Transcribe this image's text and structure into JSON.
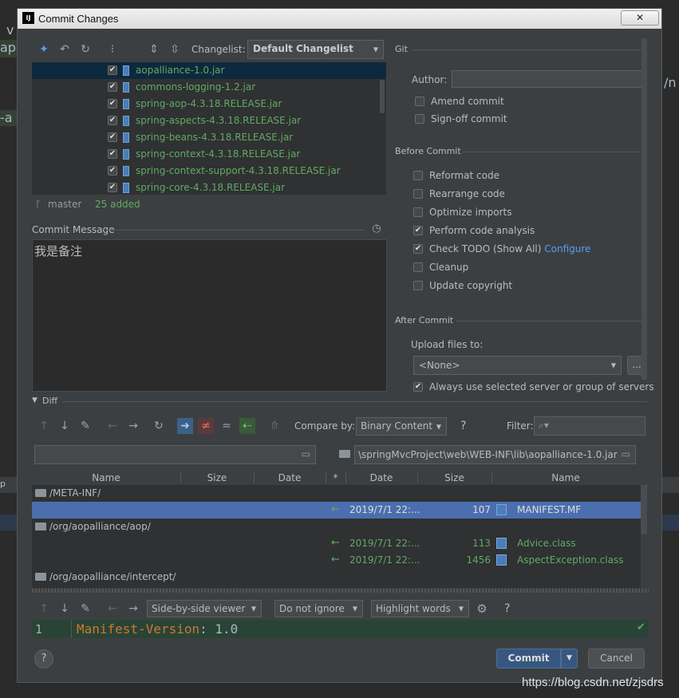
{
  "background": {
    "left_chars": [
      "v",
      "ap",
      "-a",
      "p"
    ],
    "right_chars": "/n"
  },
  "window": {
    "title": "Commit Changes",
    "app_badge": "IJ",
    "close_label": "✕"
  },
  "toolbar": {
    "changelist_label": "Changelist:",
    "changelist_value": "Default Changelist"
  },
  "files": [
    {
      "name": "aopalliance-1.0.jar",
      "checked": true,
      "selected": true
    },
    {
      "name": "commons-logging-1.2.jar",
      "checked": true
    },
    {
      "name": "spring-aop-4.3.18.RELEASE.jar",
      "checked": true
    },
    {
      "name": "spring-aspects-4.3.18.RELEASE.jar",
      "checked": true
    },
    {
      "name": "spring-beans-4.3.18.RELEASE.jar",
      "checked": true
    },
    {
      "name": "spring-context-4.3.18.RELEASE.jar",
      "checked": true
    },
    {
      "name": "spring-context-support-4.3.18.RELEASE.jar",
      "checked": true
    },
    {
      "name": "spring-core-4.3.18.RELEASE.jar",
      "checked": true
    }
  ],
  "status": {
    "branch": "master",
    "added": "25 added"
  },
  "commit_message": {
    "label": "Commit Message",
    "text": "我是备注"
  },
  "git": {
    "section": "Git",
    "author_label": "Author:",
    "author_value": "",
    "amend": "Amend commit",
    "signoff": "Sign-off commit"
  },
  "before_commit": {
    "section": "Before Commit",
    "options": [
      {
        "label": "Reformat code",
        "checked": false
      },
      {
        "label": "Rearrange code",
        "checked": false
      },
      {
        "label": "Optimize imports",
        "checked": false
      },
      {
        "label": "Perform code analysis",
        "checked": true
      },
      {
        "label": "Check TODO (Show All)",
        "checked": true,
        "link": "Configure"
      },
      {
        "label": "Cleanup",
        "checked": false
      },
      {
        "label": "Update copyright",
        "checked": false
      }
    ]
  },
  "after_commit": {
    "section": "After Commit",
    "upload_label": "Upload files to:",
    "upload_value": "<None>",
    "browse": "...",
    "always_use": "Always use selected server or group of servers",
    "always_use_checked": true
  },
  "diff": {
    "section": "Diff",
    "compare_label": "Compare by:",
    "compare_value": "Binary Content",
    "help": "?",
    "filter_label": "Filter:",
    "left_path": "",
    "right_path": "\\springMvcProject\\web\\WEB-INF\\lib\\aopalliance-1.0.jar",
    "columns_left": [
      "Name",
      "Size",
      "Date",
      "*"
    ],
    "columns_right": [
      "Date",
      "Size",
      "Name"
    ],
    "rows": [
      {
        "type": "folder",
        "path": "/META-INF/"
      },
      {
        "type": "file",
        "date": "2019/7/1 22:...",
        "size": "107",
        "name": "MANIFEST.MF",
        "selected": true
      },
      {
        "type": "folder",
        "path": "/org/aopalliance/aop/"
      },
      {
        "type": "file",
        "date": "2019/7/1 22:...",
        "size": "113",
        "name": "Advice.class"
      },
      {
        "type": "file",
        "date": "2019/7/1 22:...",
        "size": "1456",
        "name": "AspectException.class"
      },
      {
        "type": "folder",
        "path": "/org/aopalliance/intercept/"
      }
    ],
    "viewer": "Side-by-side viewer",
    "ignore": "Do not ignore",
    "highlight": "Highlight words",
    "help2": "?",
    "code_line_no": "1",
    "code_key": "Manifest-Version",
    "code_sep": ": ",
    "code_val": "1.0"
  },
  "footer": {
    "help": "?",
    "commit": "Commit",
    "cancel": "Cancel"
  },
  "watermark": "https://blog.csdn.net/zjsdrs",
  "colors": {
    "accent": "#365880",
    "added_green": "#62a962",
    "link": "#589df6"
  }
}
